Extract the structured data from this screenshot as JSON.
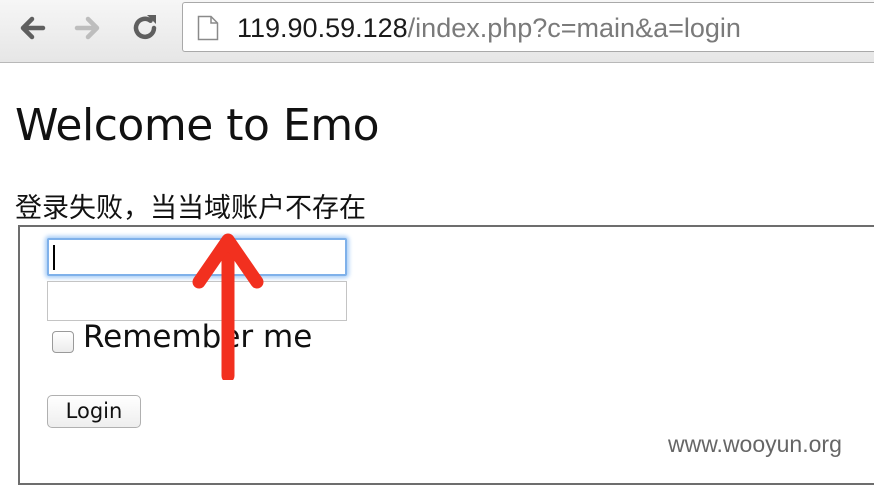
{
  "browser": {
    "url_host": "119.90.59.128",
    "url_path": "/index.php?c=main&a=login",
    "icons": {
      "back": "arrow-left-icon",
      "forward": "arrow-right-icon",
      "reload": "reload-icon",
      "page": "page-icon"
    }
  },
  "page": {
    "heading": "Welcome to Emo",
    "error_message": "登录失败，当当域账户不存在",
    "form": {
      "username_value": "",
      "password_value": "",
      "remember_label": "Remember me",
      "remember_checked": false,
      "login_label": "Login"
    }
  },
  "annotation": {
    "type": "red-arrow-up",
    "color": "#f2301f"
  },
  "watermark": "www.wooyun.org"
}
